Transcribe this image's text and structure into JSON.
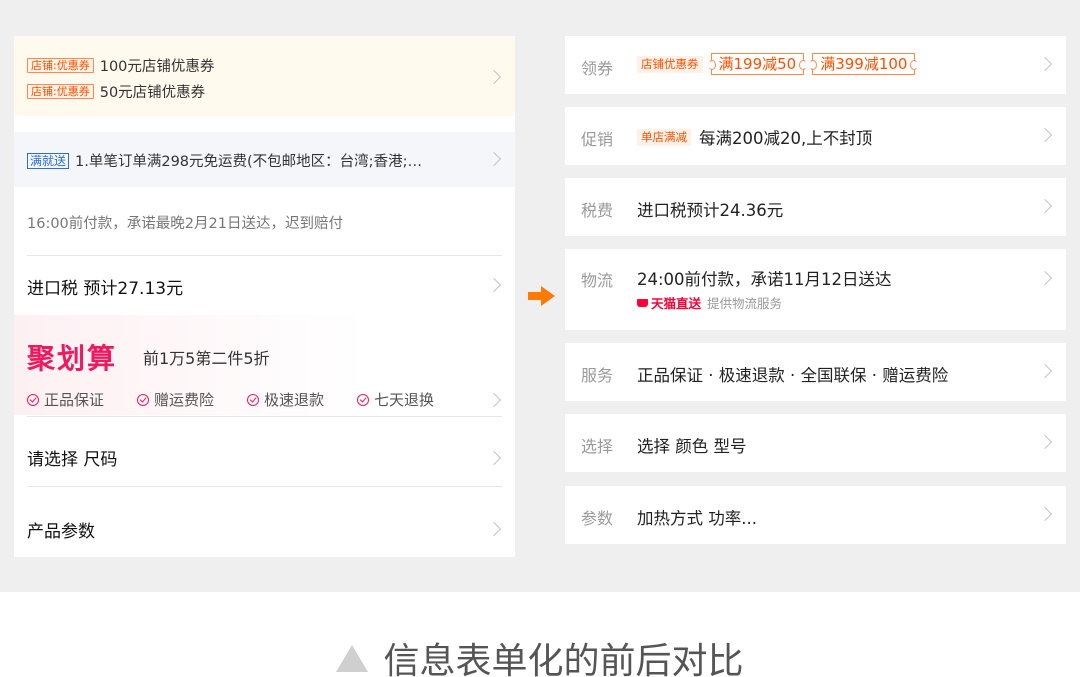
{
  "before": {
    "coupons": [
      {
        "tag": "店铺:优惠券",
        "text": "100元店铺优惠券"
      },
      {
        "tag": "店铺:优惠券",
        "text": "50元店铺优惠券"
      }
    ],
    "shipping": {
      "tag": "满就送",
      "text": "1.单笔订单满298元免运费(不包邮地区：台湾;香港;…"
    },
    "delivery": "16:00前付款，承诺最晚2月21日送达，迟到赔付",
    "tax": "进口税 预计27.13元",
    "juhuasuan": {
      "logo": "聚划算",
      "promo": "前1万5第二件5折",
      "guarantees": [
        "正品保证",
        "赠运费险",
        "极速退款",
        "七天退换"
      ]
    },
    "select": "请选择 尺码",
    "params": "产品参数"
  },
  "after": {
    "coupon": {
      "label": "领券",
      "tag": "店铺优惠券",
      "tickets": [
        "满199减50",
        "满399减100"
      ]
    },
    "promo": {
      "label": "促销",
      "tag": "单店满减",
      "text": "每满200减20,上不封顶"
    },
    "tax": {
      "label": "税费",
      "text": "进口税预计24.36元"
    },
    "logistics": {
      "label": "物流",
      "text": "24:00前付款，承诺11月12日送达",
      "brand": "天猫直送",
      "note": "提供物流服务"
    },
    "service": {
      "label": "服务",
      "text": "正品保证 · 极速退款 · 全国联保 · 赠运费险"
    },
    "choose": {
      "label": "选择",
      "text": "选择 颜色 型号"
    },
    "params": {
      "label": "参数",
      "text": "加热方式 功率..."
    }
  },
  "caption": "信息表单化的前后对比",
  "colors": {
    "accent": "#ff5000",
    "juhuasuan": "#f0185e",
    "tmall": "#ff0036",
    "arrow": "#ff7a00"
  }
}
